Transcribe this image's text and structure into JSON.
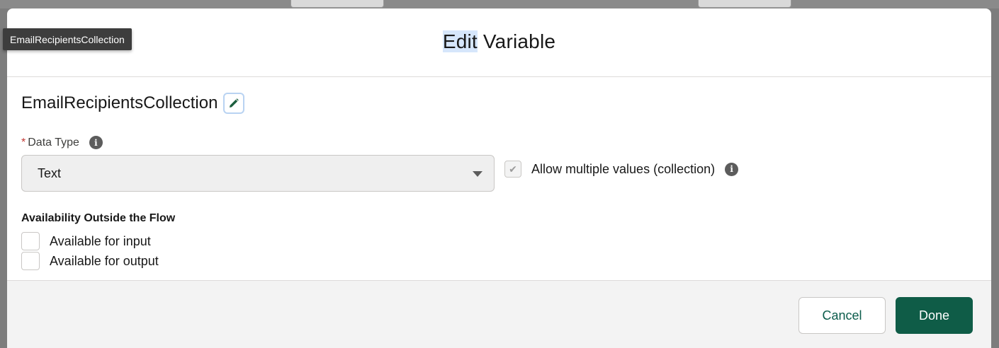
{
  "tooltip": {
    "text": "EmailRecipientsCollection"
  },
  "modal": {
    "title_highlight": "Edit",
    "title_rest": " Variable"
  },
  "variable": {
    "api_name": "EmailRecipientsCollection"
  },
  "data_type": {
    "required_marker": "*",
    "label": "Data Type",
    "selected_value": "Text"
  },
  "collection": {
    "label": "Allow multiple values (collection)",
    "checked": true,
    "disabled": true
  },
  "availability": {
    "title": "Availability Outside the Flow",
    "options": [
      {
        "label": "Available for input",
        "checked": false
      },
      {
        "label": "Available for output",
        "checked": false
      }
    ]
  },
  "footer": {
    "cancel_label": "Cancel",
    "done_label": "Done"
  },
  "colors": {
    "brand_button": "#0f5c47",
    "required": "#c23934",
    "title_highlight": "#d6e6fb"
  },
  "icons": {
    "edit": "pencil-icon",
    "info": "info-icon",
    "dropdown": "chevron-down-icon",
    "check": "checkmark-icon"
  }
}
